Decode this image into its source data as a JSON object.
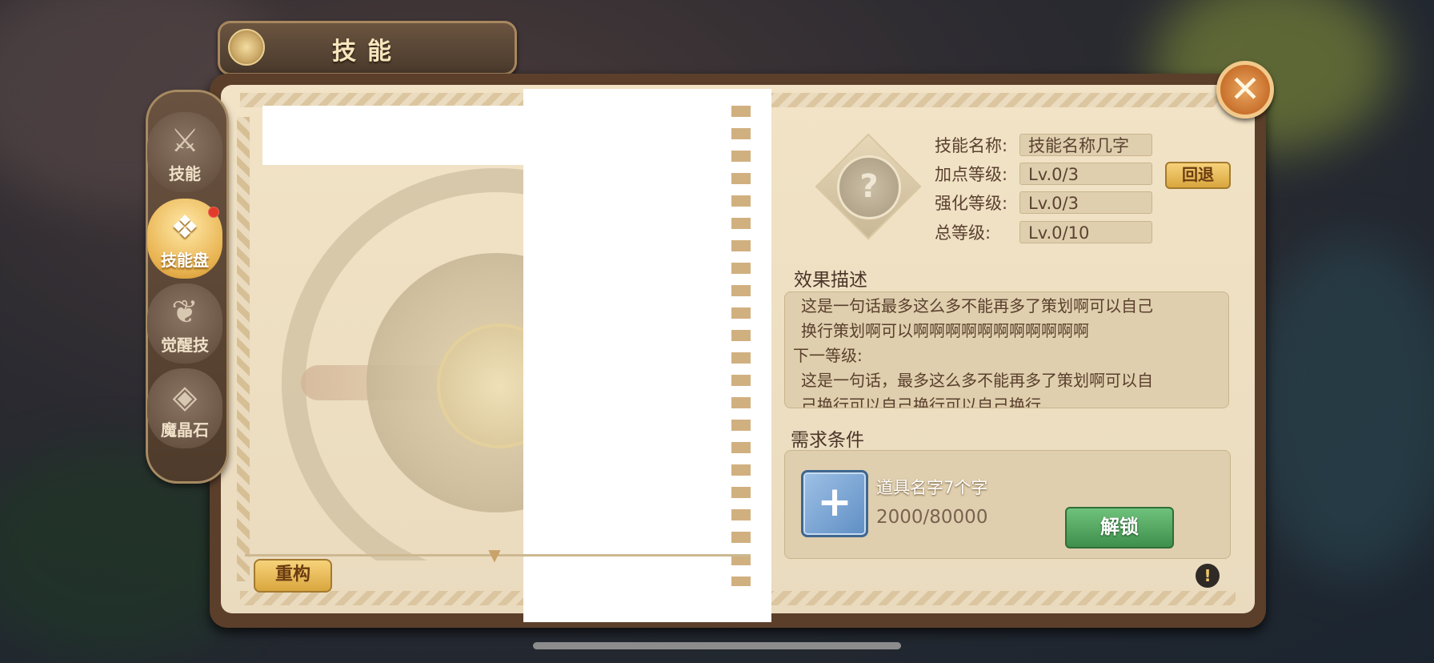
{
  "header": {
    "title": "技能"
  },
  "sidebar": {
    "items": [
      {
        "label": "技能",
        "icon": "winged-sword-icon",
        "active": false
      },
      {
        "label": "技能盘",
        "icon": "diamond-cluster-icon",
        "active": true,
        "badge": true
      },
      {
        "label": "觉醒技",
        "icon": "phoenix-icon",
        "active": false
      },
      {
        "label": "魔晶石",
        "icon": "crystal-gems-icon",
        "active": false
      }
    ]
  },
  "wheel": {
    "rebuild_label": "重构"
  },
  "skill": {
    "icon_glyph": "?",
    "name_label": "技能名称:",
    "name_value": "技能名称几字",
    "points_label": "加点等级:",
    "points_value": "Lv.0/3",
    "enhance_label": "强化等级:",
    "enhance_value": "Lv.0/3",
    "total_label": "总等级:",
    "total_value": "Lv.0/10",
    "back_label": "回退"
  },
  "effect": {
    "title": "效果描述",
    "line1": "这是一句话最多这么多不能再多了策划啊可以自己",
    "line2": "换行策划啊可以啊啊啊啊啊啊啊啊啊啊啊",
    "next_label": "下一等级:",
    "line3": "这是一句话，最多这么多不能再多了策划啊可以自",
    "line4": "己换行可以自己换行可以自己换行"
  },
  "requirement": {
    "title": "需求条件",
    "item_name": "道具名字7个字",
    "item_count": "2000/80000",
    "unlock_label": "解锁"
  },
  "colors": {
    "accent_gold": "#d9a63e",
    "unlock_green": "#3f8f4c",
    "close_orange": "#c8702c"
  }
}
